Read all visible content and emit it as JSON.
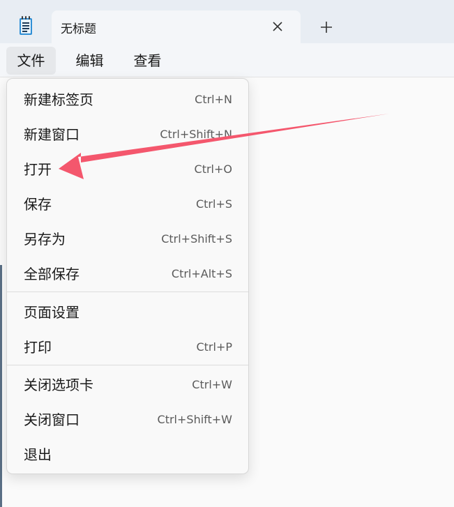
{
  "tab": {
    "title": "无标题",
    "close_icon": "close-icon",
    "new_tab_icon": "plus-icon"
  },
  "app_icon": "notepad-icon",
  "menubar": {
    "file": "文件",
    "edit": "编辑",
    "view": "查看"
  },
  "file_menu": {
    "items": [
      {
        "label": "新建标签页",
        "shortcut": "Ctrl+N"
      },
      {
        "label": "新建窗口",
        "shortcut": "Ctrl+Shift+N"
      },
      {
        "label": "打开",
        "shortcut": "Ctrl+O"
      },
      {
        "label": "保存",
        "shortcut": "Ctrl+S"
      },
      {
        "label": "另存为",
        "shortcut": "Ctrl+Shift+S"
      },
      {
        "label": "全部保存",
        "shortcut": "Ctrl+Alt+S"
      },
      {
        "label": "页面设置",
        "shortcut": ""
      },
      {
        "label": "打印",
        "shortcut": "Ctrl+P"
      },
      {
        "label": "关闭选项卡",
        "shortcut": "Ctrl+W"
      },
      {
        "label": "关闭窗口",
        "shortcut": "Ctrl+Shift+W"
      },
      {
        "label": "退出",
        "shortcut": ""
      }
    ]
  },
  "annotation": {
    "arrow_color": "#f4576d",
    "points_to": "打开"
  }
}
